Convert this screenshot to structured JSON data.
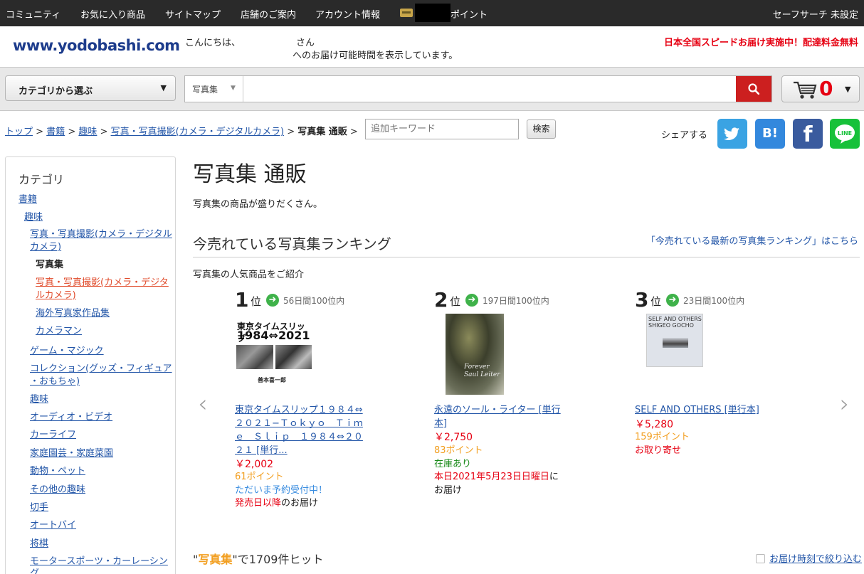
{
  "topbar": {
    "community": "コミュニティ",
    "favorites": "お気に入り商品",
    "sitemap": "サイトマップ",
    "stores": "店舗のご案内",
    "account": "アカウント情報",
    "points": "ポイント",
    "safesearch": "セーフサーチ 未設定"
  },
  "header": {
    "logo_main": "www.",
    "logo_brand": "yodobashi",
    "logo_suffix": ".com",
    "greeting": "こんにちは、",
    "san": "さん",
    "delivery_note": "へのお届け可能時間を表示しています。",
    "promo": "日本全国スピードお届け実施中！配達料金無料"
  },
  "searchbar": {
    "category_button": "カテゴリから選ぶ",
    "scope": "写真集",
    "query": "",
    "cart_count": "0"
  },
  "breadcrumb": {
    "items": [
      "トップ",
      "書籍",
      "趣味",
      "写真・写真撮影(カメラ・デジタルカメラ)"
    ],
    "current": "写真集 通販",
    "keyword_placeholder": "追加キーワード",
    "search_button": "検索",
    "share_label": "シェアする",
    "hatena": "B!",
    "facebook": "f",
    "line": "LINE"
  },
  "sidebar": {
    "title": "カテゴリ",
    "items": [
      "書籍",
      "趣味",
      "写真・写真撮影(カメラ・デジタル",
      "カメラ)",
      "写真集",
      "写真・写真撮影(カメラ・デジタ",
      "ルカメラ)",
      "海外写真家作品集",
      "カメラマン",
      "ゲーム・マジック",
      "コレクション(グッズ・フィギュア",
      "・おもちゃ)",
      "趣味",
      "オーディオ・ビデオ",
      "カーライフ",
      "家庭園芸・家庭菜園",
      "動物・ペット",
      "その他の趣味",
      "切手",
      "オートバイ",
      "将棋",
      "モータースポーツ・カーレーシン",
      "グ"
    ]
  },
  "main": {
    "title": "写真集 通販",
    "description": "写真集の商品が盛りだくさん。",
    "ranking_title": "今売れている写真集ランキング",
    "ranking_link": "「今売れている最新の写真集ランキング」はこちら",
    "ranking_sub": "写真集の人気商品をご紹介",
    "rank_suffix": "位",
    "rankings": [
      {
        "rank": "1",
        "days": "56日間100位内",
        "cover_line1": "東京タイムスリップ",
        "cover_line2": "1984⇔2021",
        "cover_author": "善本喜一郎",
        "name_lines": [
          "東京タイムスリップ１９８４⇔",
          "２０２１−Ｔｏｋｙｏ　Ｔｉｍ",
          "ｅ　Ｓｌｉｐ　１９８４⇔２０",
          "２１ [単行..."
        ],
        "price": "￥2,002",
        "points": "61ポイント",
        "status": "ただいま予約受付中！",
        "delivery_red": "発売日以降",
        "delivery_rest": "のお届け"
      },
      {
        "rank": "2",
        "days": "197日間100位内",
        "cover_text": "Forever Saul Leiter",
        "name_lines": [
          "永遠のソール・ライター [単行",
          "本]"
        ],
        "price": "￥2,750",
        "points": "83ポイント",
        "status": "在庫あり",
        "delivery_red": "本日2021年5月23日日曜日",
        "delivery_rest": "に",
        "delivery_line2": "お届け"
      },
      {
        "rank": "3",
        "days": "23日間100位内",
        "cover_text": "SELF AND OTHERS SHIGEO GOCHO",
        "name_lines": [
          "SELF AND OTHERS [単行本]"
        ],
        "price": "￥5,280",
        "points": "159ポイント",
        "status": "お取り寄せ"
      }
    ],
    "hits_quote_open": "\"",
    "hits_keyword": "写真集",
    "hits_rest": "\"で1709件ヒット",
    "filter_label": "お届け時刻で絞り込む"
  }
}
